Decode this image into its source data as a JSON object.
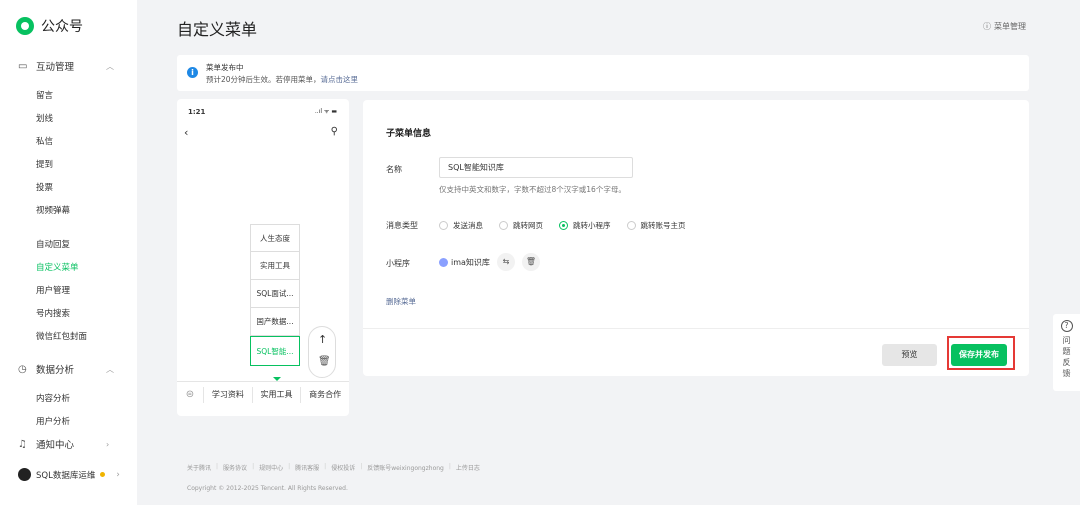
{
  "brand": {
    "name": "公众号"
  },
  "sidebar": {
    "groups": [
      {
        "label": "互动管理",
        "icon": "message-icon"
      },
      {
        "label": "数据分析",
        "icon": "clock-icon"
      },
      {
        "label": "通知中心",
        "icon": "bell-icon"
      }
    ],
    "items": [
      {
        "label": "留言"
      },
      {
        "label": "划线"
      },
      {
        "label": "私信"
      },
      {
        "label": "提到"
      },
      {
        "label": "投票"
      },
      {
        "label": "视频弹幕"
      },
      {
        "label": "自动回复"
      },
      {
        "label": "自定义菜单"
      },
      {
        "label": "用户管理"
      },
      {
        "label": "号内搜索"
      },
      {
        "label": "微信红包封面"
      },
      {
        "label": "内容分析"
      },
      {
        "label": "用户分析"
      }
    ],
    "account": "SQL数据库运维"
  },
  "header": {
    "title": "自定义菜单",
    "manage_link": "菜单管理"
  },
  "notice": {
    "title": "菜单发布中",
    "text": "预计20分钟后生效。若停用菜单，",
    "link": "请点击这里"
  },
  "phone": {
    "time": "1:21",
    "status": "..ıl ᯤ ▬",
    "submenu": [
      {
        "label": "人生态度"
      },
      {
        "label": "实用工具"
      },
      {
        "label": "SQL面试..."
      },
      {
        "label": "国产数据..."
      },
      {
        "label": "SQL智能..."
      }
    ],
    "menubar": [
      {
        "label": "学习资料"
      },
      {
        "label": "实用工具"
      },
      {
        "label": "商务合作"
      }
    ]
  },
  "editor": {
    "section_title": "子菜单信息",
    "name_label": "名称",
    "name_value": "SQL智能知识库",
    "name_hint": "仅支持中英文和数字，字数不超过8个汉字或16个字母。",
    "type_label": "消息类型",
    "types": [
      {
        "label": "发送消息",
        "selected": false
      },
      {
        "label": "跳转网页",
        "selected": false
      },
      {
        "label": "跳转小程序",
        "selected": true
      },
      {
        "label": "跳转账号主页",
        "selected": false
      }
    ],
    "miniprogram_label": "小程序",
    "miniprogram_name": "ima知识库",
    "delete_link": "删除菜单",
    "preview_button": "预览",
    "publish_button": "保存并发布"
  },
  "feedback": {
    "label": "问题反馈"
  },
  "footer": {
    "links": [
      {
        "label": "关于腾讯"
      },
      {
        "label": "服务协议"
      },
      {
        "label": "规则中心"
      },
      {
        "label": "腾讯客服"
      },
      {
        "label": "侵权投诉"
      },
      {
        "label": "反馈账号weixingongzhong"
      },
      {
        "label": "上传日志"
      }
    ],
    "copyright": "Copyright © 2012-2025 Tencent. All Rights Reserved."
  },
  "colors": {
    "accent": "#07c160",
    "link": "#576b95",
    "info": "#1e88e5",
    "highlight": "#e53935"
  }
}
